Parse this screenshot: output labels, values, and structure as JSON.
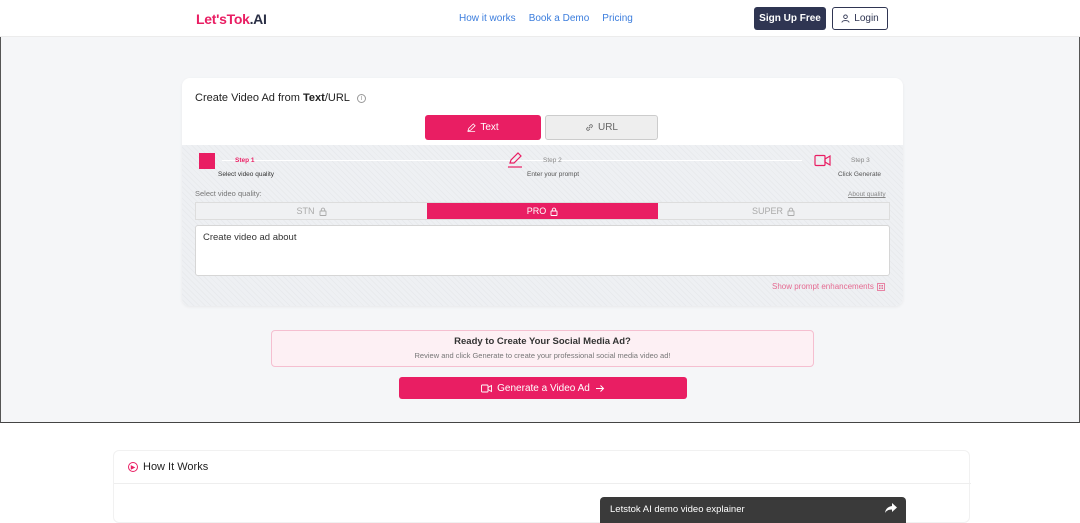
{
  "header": {
    "logo_lets": "Let'sTok",
    "logo_ai": ".AI",
    "nav": [
      "How it works",
      "Book a Demo",
      "Pricing"
    ],
    "signup_label": "Sign Up Free",
    "login_label": "Login"
  },
  "card": {
    "title_prefix": "Create Video Ad from ",
    "title_bold": "Text",
    "title_suffix": "/URL",
    "tabs": {
      "text": "Text",
      "url": "URL"
    },
    "steps": [
      {
        "label": "Step 1",
        "desc": "Select video quality"
      },
      {
        "label": "Step 2",
        "desc": "Enter your prompt"
      },
      {
        "label": "Step 3",
        "desc": "Click Generate"
      }
    ],
    "quality_label": "Select video quality:",
    "about_quality": "About quality",
    "quality_options": [
      "STN",
      "PRO",
      "SUPER"
    ],
    "selected_quality": "PRO",
    "prompt_value": "Create video ad about",
    "enhance_label": "Show prompt enhancements"
  },
  "ready": {
    "title": "Ready to Create Your Social Media Ad?",
    "subtitle": "Review and click Generate to create your professional social media video ad!"
  },
  "generate_label": "Generate a Video Ad",
  "how": {
    "title": "How It Works",
    "video_title": "Letstok AI demo video explainer"
  },
  "colors": {
    "accent": "#e91e63",
    "navy": "#2f3552",
    "link": "#3b7ddd"
  }
}
